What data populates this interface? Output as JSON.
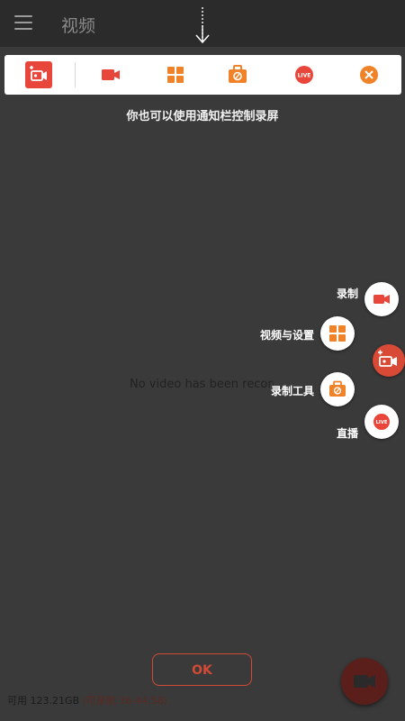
{
  "app_bar": {
    "title": "视频",
    "menu_icon": "hamburger-icon"
  },
  "hint": {
    "arrow_icon": "down-arrow-icon",
    "text": "你也可以使用通知栏控制录屏"
  },
  "toolbar": {
    "items": [
      {
        "icon": "video-camera-add-icon",
        "selected": true
      },
      {
        "icon": "video-camera-icon"
      },
      {
        "icon": "grid-icon"
      },
      {
        "icon": "toolbox-icon"
      },
      {
        "icon": "live-icon",
        "label": "LIVE"
      },
      {
        "icon": "close-icon"
      }
    ]
  },
  "empty_state": "No video has been recorded",
  "fab_menu": {
    "items": [
      {
        "label": "录制",
        "icon": "video-camera-icon"
      },
      {
        "label": "视频与设置",
        "icon": "grid-icon"
      },
      {
        "label": "录制工具",
        "icon": "toolbox-icon"
      },
      {
        "label": "直播",
        "icon": "live-icon",
        "icon_text": "LIVE"
      }
    ],
    "main_icon": "video-camera-add-icon"
  },
  "ok_button": "OK",
  "storage": {
    "text": "可用 123.21GB",
    "recordable": "(可录制 36:44:58)"
  },
  "record_fab_icon": "video-camera-icon",
  "colors": {
    "accent": "#e8463a",
    "orange": "#f0832a",
    "background": "#3a3a3a"
  }
}
